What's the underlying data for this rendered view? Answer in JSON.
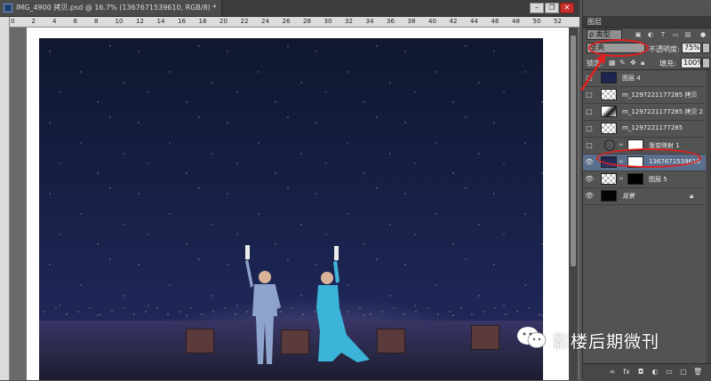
{
  "document": {
    "tab_title": "IMG_4900 拷贝.psd @ 16.7% (1367671539610, RGB/8) *",
    "ruler_numbers": [
      "0",
      "2",
      "4",
      "6",
      "8",
      "10",
      "12",
      "14",
      "16",
      "18",
      "20",
      "22",
      "24",
      "26",
      "28",
      "30",
      "32",
      "34",
      "36",
      "38",
      "40",
      "42",
      "44",
      "46",
      "48",
      "50",
      "52"
    ]
  },
  "window_buttons": {
    "minimize": "–",
    "restore": "❐",
    "close": "✕"
  },
  "layers_panel": {
    "title": "图层",
    "filter_label": "ρ 类型",
    "blend_mode": "变亮",
    "opacity_label": "不透明度:",
    "opacity_value": "75%",
    "lock_label": "锁定:",
    "fill_label": "填充:",
    "fill_value": "100%",
    "layers": [
      {
        "name": "图层 4",
        "visible": false,
        "selected": false
      },
      {
        "name": "m_1297221177285 拷贝",
        "visible": false,
        "selected": false
      },
      {
        "name": "m_1297221177285 拷贝 2",
        "visible": false,
        "selected": false
      },
      {
        "name": "m_1297221177285",
        "visible": false,
        "selected": false
      },
      {
        "name": "渐变映射 1",
        "visible": false,
        "selected": false
      },
      {
        "name": "1367671539610",
        "visible": true,
        "selected": true
      },
      {
        "name": "图层 5",
        "visible": true,
        "selected": false
      },
      {
        "name": "背景",
        "visible": true,
        "selected": false
      }
    ],
    "footer_icons": [
      "link-icon",
      "fx-icon",
      "mask-icon",
      "adjustment-icon",
      "folder-icon",
      "new-layer-icon",
      "trash-icon"
    ],
    "footer_glyphs": [
      "∞",
      "fx",
      "◘",
      "◐",
      "▭",
      "▢",
      "🗑"
    ]
  },
  "watermark": {
    "text": "影楼后期微刊"
  },
  "colors": {
    "annotation_red": "#e02020",
    "selected_layer": "#5a6f8d"
  }
}
